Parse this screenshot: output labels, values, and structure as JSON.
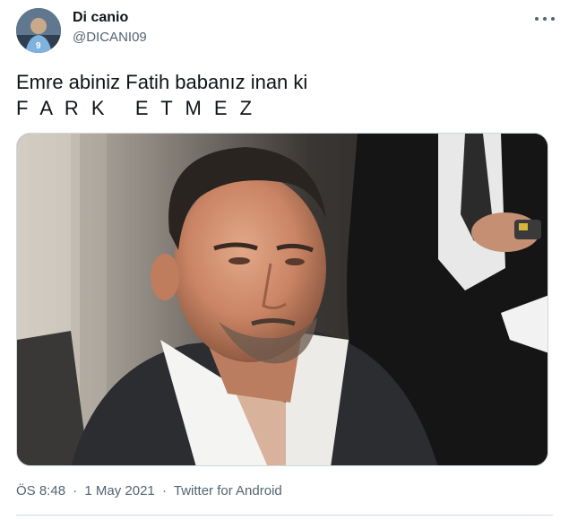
{
  "author": {
    "display_name": "Di canio",
    "handle": "@DICANI09",
    "avatar_icon": "avatar-photo"
  },
  "tweet": {
    "text_line1": "Emre abiniz Fatih babanız inan ki",
    "text_line2": "F A R K   E T M E Z"
  },
  "media": {
    "type": "photo"
  },
  "meta": {
    "time": "ÖS 8:48",
    "separator": "·",
    "date": "1 May 2021",
    "source": "Twitter for Android"
  },
  "icons": {
    "more": "more-horizontal-icon"
  },
  "colors": {
    "text_primary": "#0f1419",
    "text_secondary": "#536471",
    "border": "#cfd9de"
  }
}
